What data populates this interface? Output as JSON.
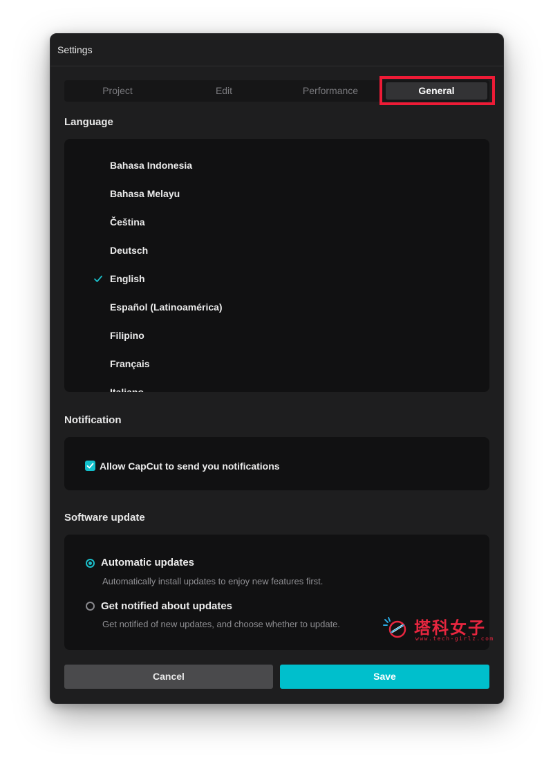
{
  "window": {
    "title": "Settings"
  },
  "tabs": [
    {
      "label": "Project",
      "active": false
    },
    {
      "label": "Edit",
      "active": false
    },
    {
      "label": "Performance",
      "active": false
    },
    {
      "label": "General",
      "active": true
    }
  ],
  "language": {
    "title": "Language",
    "items": [
      {
        "label": "Bahasa Indonesia",
        "selected": false
      },
      {
        "label": "Bahasa Melayu",
        "selected": false
      },
      {
        "label": "Čeština",
        "selected": false
      },
      {
        "label": "Deutsch",
        "selected": false
      },
      {
        "label": "English",
        "selected": true
      },
      {
        "label": "Español (Latinoamérica)",
        "selected": false
      },
      {
        "label": "Filipino",
        "selected": false
      },
      {
        "label": "Français",
        "selected": false
      },
      {
        "label": "Italiano",
        "selected": false
      }
    ]
  },
  "notification": {
    "title": "Notification",
    "allow_label": "Allow CapCut to send you notifications",
    "allow_checked": true
  },
  "software_update": {
    "title": "Software update",
    "options": [
      {
        "label": "Automatic updates",
        "description": "Automatically install updates to enjoy new features first.",
        "selected": true
      },
      {
        "label": "Get notified about updates",
        "description": "Get notified of new updates, and choose whether to update.",
        "selected": false
      }
    ]
  },
  "buttons": {
    "cancel": "Cancel",
    "save": "Save"
  },
  "watermark": {
    "text": "塔科女子",
    "sub": "www.tech-girlz.com"
  },
  "colors": {
    "accent": "#00bfcc",
    "highlight": "#ee1b36",
    "panel_bg": "#111112",
    "window_bg": "#1e1e1f"
  }
}
